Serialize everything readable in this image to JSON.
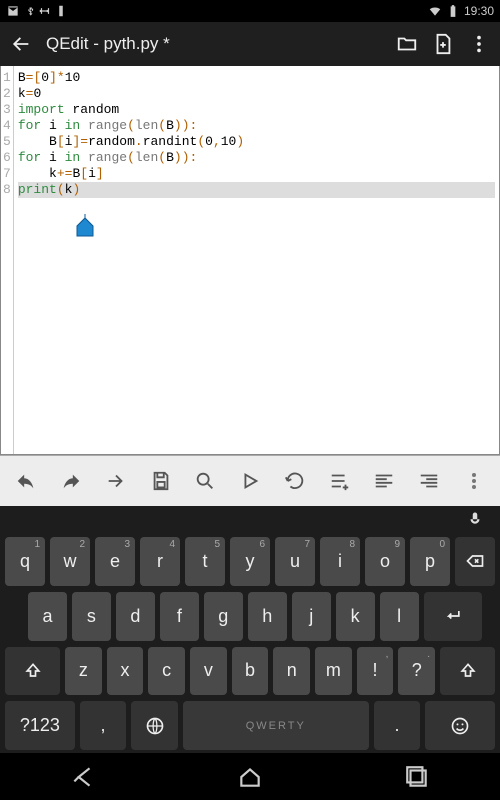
{
  "status": {
    "time": "19:30"
  },
  "actionbar": {
    "title": "QEdit - pyth.py *"
  },
  "code": {
    "gutter": "1\n2\n3\n4\n5\n6\n7\n8",
    "lines": [
      [
        {
          "t": "id",
          "v": "B"
        },
        {
          "t": "op",
          "v": "="
        },
        {
          "t": "op",
          "v": "["
        },
        {
          "t": "id",
          "v": "0"
        },
        {
          "t": "op",
          "v": "]"
        },
        {
          "t": "op",
          "v": "*"
        },
        {
          "t": "id",
          "v": "10"
        }
      ],
      [
        {
          "t": "id",
          "v": "k"
        },
        {
          "t": "op",
          "v": "="
        },
        {
          "t": "id",
          "v": "0"
        }
      ],
      [
        {
          "t": "kw",
          "v": "import"
        },
        {
          "t": "id",
          "v": " random"
        }
      ],
      [
        {
          "t": "kw",
          "v": "for"
        },
        {
          "t": "id",
          "v": " i "
        },
        {
          "t": "kw",
          "v": "in"
        },
        {
          "t": "id",
          "v": " "
        },
        {
          "t": "fn",
          "v": "range"
        },
        {
          "t": "op",
          "v": "("
        },
        {
          "t": "fn",
          "v": "len"
        },
        {
          "t": "op",
          "v": "("
        },
        {
          "t": "id",
          "v": "B"
        },
        {
          "t": "op",
          "v": ")"
        },
        {
          "t": "op",
          "v": ")"
        },
        {
          "t": "op",
          "v": ":"
        }
      ],
      [
        {
          "t": "id",
          "v": "    B"
        },
        {
          "t": "op",
          "v": "["
        },
        {
          "t": "id",
          "v": "i"
        },
        {
          "t": "op",
          "v": "]"
        },
        {
          "t": "op",
          "v": "="
        },
        {
          "t": "id",
          "v": "random"
        },
        {
          "t": "op",
          "v": "."
        },
        {
          "t": "id",
          "v": "randint"
        },
        {
          "t": "op",
          "v": "("
        },
        {
          "t": "id",
          "v": "0"
        },
        {
          "t": "op",
          "v": ","
        },
        {
          "t": "id",
          "v": "10"
        },
        {
          "t": "op",
          "v": ")"
        }
      ],
      [
        {
          "t": "kw",
          "v": "for"
        },
        {
          "t": "id",
          "v": " i "
        },
        {
          "t": "kw",
          "v": "in"
        },
        {
          "t": "id",
          "v": " "
        },
        {
          "t": "fn",
          "v": "range"
        },
        {
          "t": "op",
          "v": "("
        },
        {
          "t": "fn",
          "v": "len"
        },
        {
          "t": "op",
          "v": "("
        },
        {
          "t": "id",
          "v": "B"
        },
        {
          "t": "op",
          "v": ")"
        },
        {
          "t": "op",
          "v": ")"
        },
        {
          "t": "op",
          "v": ":"
        }
      ],
      [
        {
          "t": "id",
          "v": "    k"
        },
        {
          "t": "op",
          "v": "+="
        },
        {
          "t": "id",
          "v": "B"
        },
        {
          "t": "op",
          "v": "["
        },
        {
          "t": "id",
          "v": "i"
        },
        {
          "t": "op",
          "v": "]"
        }
      ],
      [
        {
          "t": "kw",
          "v": "print"
        },
        {
          "t": "op",
          "v": "("
        },
        {
          "t": "id",
          "v": "k"
        },
        {
          "t": "op",
          "v": ")"
        }
      ]
    ],
    "active_line": 8
  },
  "keyboard": {
    "row1": [
      {
        "k": "q",
        "h": "1"
      },
      {
        "k": "w",
        "h": "2"
      },
      {
        "k": "e",
        "h": "3"
      },
      {
        "k": "r",
        "h": "4"
      },
      {
        "k": "t",
        "h": "5"
      },
      {
        "k": "y",
        "h": "6"
      },
      {
        "k": "u",
        "h": "7"
      },
      {
        "k": "i",
        "h": "8"
      },
      {
        "k": "o",
        "h": "9"
      },
      {
        "k": "p",
        "h": "0"
      }
    ],
    "row2": [
      {
        "k": "a"
      },
      {
        "k": "s"
      },
      {
        "k": "d"
      },
      {
        "k": "f"
      },
      {
        "k": "g"
      },
      {
        "k": "h"
      },
      {
        "k": "j"
      },
      {
        "k": "k"
      },
      {
        "k": "l"
      }
    ],
    "row3": [
      {
        "k": "z"
      },
      {
        "k": "x"
      },
      {
        "k": "c"
      },
      {
        "k": "v"
      },
      {
        "k": "b"
      },
      {
        "k": "n"
      },
      {
        "k": "m"
      },
      {
        "k": "!",
        "h": ","
      },
      {
        "k": "?",
        "h": "."
      }
    ],
    "row4": {
      "symkey": "?123",
      "comma": ",",
      "space": "QWERTY",
      "dot": "."
    }
  }
}
